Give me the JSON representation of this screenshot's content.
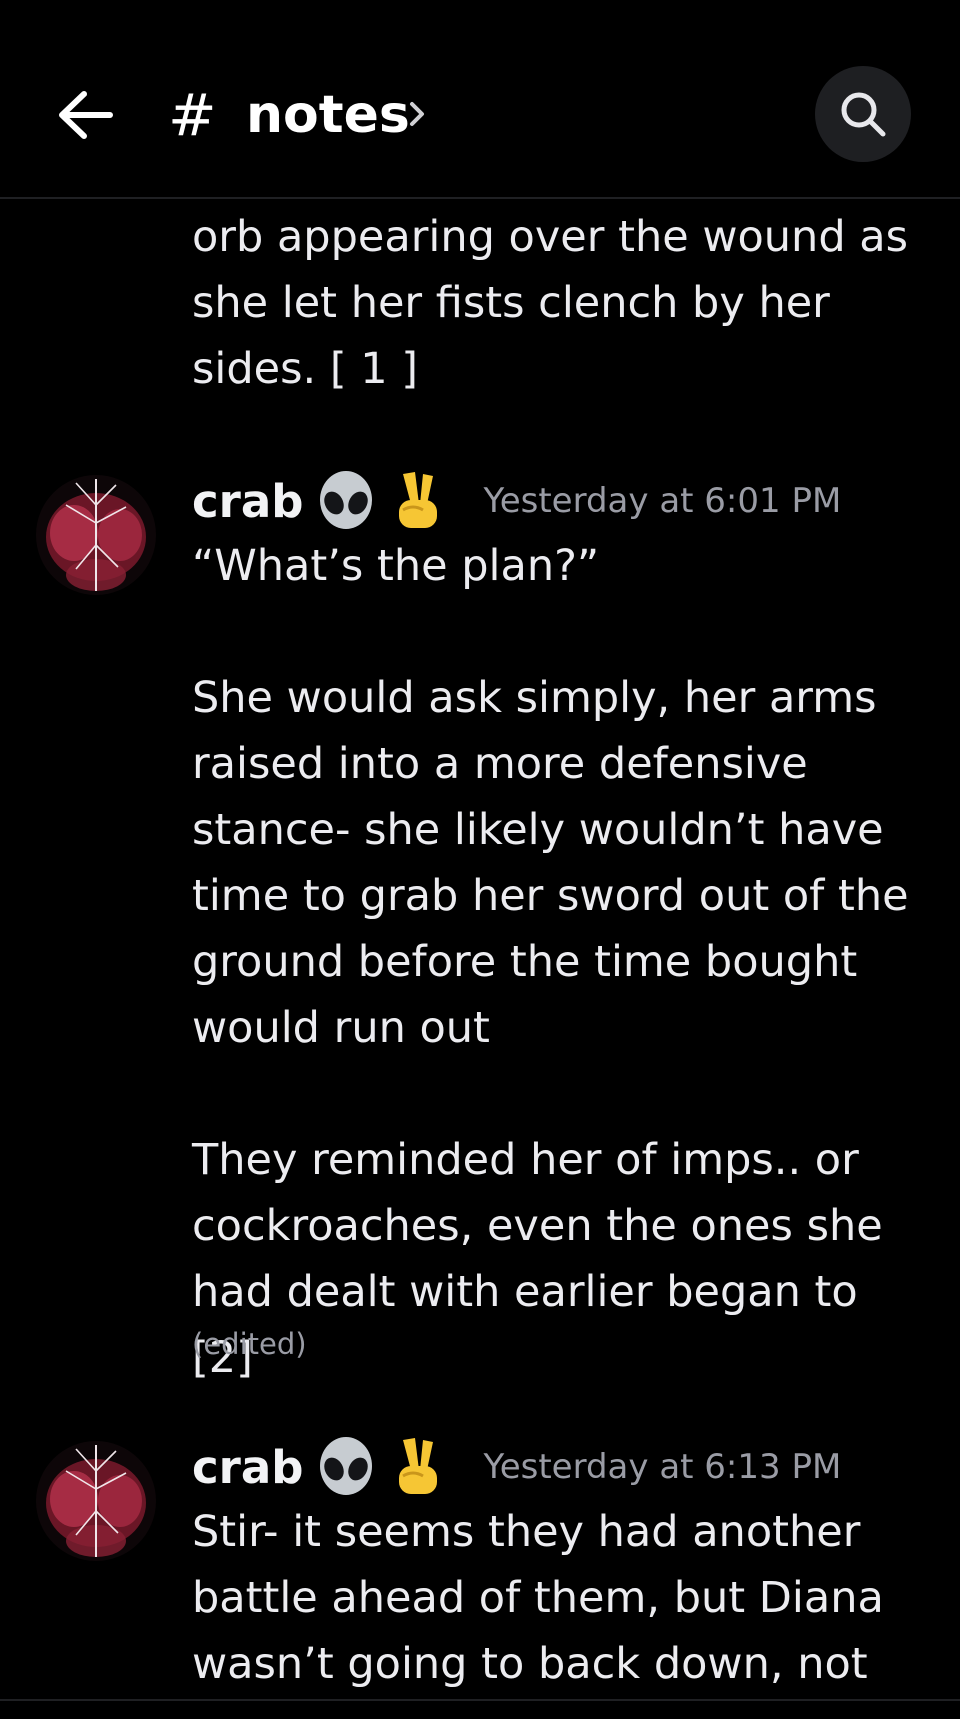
{
  "header": {
    "back_icon": "arrow-left-icon",
    "hash_symbol": "#",
    "channel_name": "notes",
    "chevron_icon": "chevron-right-icon",
    "search_icon": "search-icon"
  },
  "messages": [
    {
      "continued": true,
      "text": "orb appearing over the wound as\nshe let her fists clench by her\nsides. [ 1 ]"
    },
    {
      "author": "crab",
      "author_icons": [
        "alien-emoji-icon",
        "victory-hand-emoji-icon"
      ],
      "timestamp": "Yesterday at 6:01 PM",
      "text": "“What’s the plan?”\n\nShe would ask simply, her arms\nraised into a more defensive\nstance- she likely wouldn’t have\ntime to grab her sword out of the\nground before the time bought\nwould run out\n\nThey reminded her of imps.. or\ncockroaches, even the ones she\nhad dealt with earlier began to [2]",
      "edited_label": "(edited)"
    },
    {
      "author": "crab",
      "author_icons": [
        "alien-emoji-icon",
        "victory-hand-emoji-icon"
      ],
      "timestamp": "Yesterday at 6:13 PM",
      "text": "Stir- it seems they had another\nbattle ahead of them, but Diana\nwasn’t going to back down, not"
    }
  ],
  "colors": {
    "background": "#000000",
    "text": "#ececf0",
    "muted": "#9a9ca5",
    "search_button_bg": "#1e1f22",
    "avatar_accent": "#b0304a"
  }
}
